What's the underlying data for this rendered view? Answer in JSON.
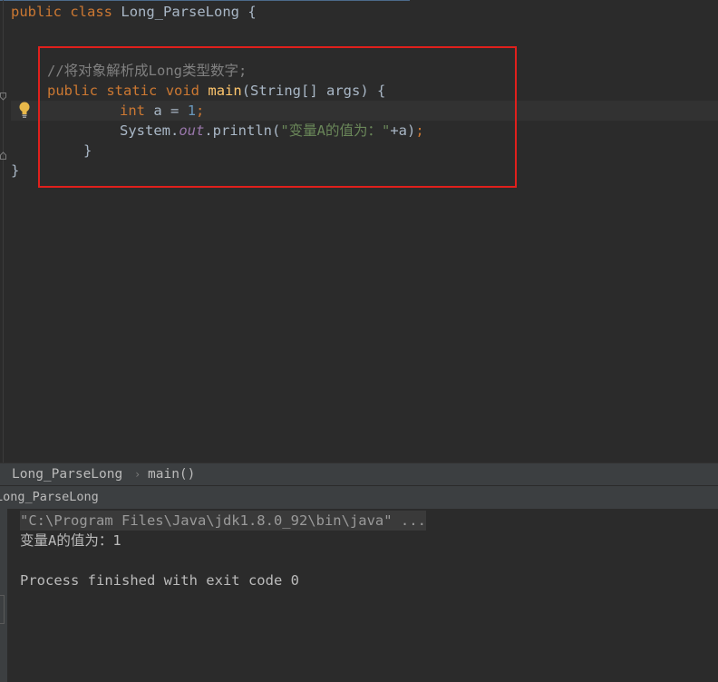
{
  "editor": {
    "class_decl": {
      "kw_public": "public",
      "kw_class": "class",
      "name": "Long_ParseLong",
      "brace": "{"
    },
    "comment": "//将对象解析成Long类型数字;",
    "method_decl": {
      "kw_public": "public",
      "kw_static": "static",
      "kw_void": "void",
      "name": "main",
      "params": "(String[] args) {"
    },
    "var_decl": {
      "kw_int": "int",
      "rest": "a =",
      "value": "1",
      "semicolon": ";"
    },
    "print_stmt": {
      "prefix": "System.",
      "field": "out",
      "call": ".println(",
      "string": "\"变量A的值为：\"",
      "suffix": "+a)",
      "semicolon": ";"
    },
    "method_close": "}",
    "class_close": "}"
  },
  "breadcrumb": {
    "items": [
      "Long_ParseLong",
      "main()"
    ],
    "separator": "›"
  },
  "run_panel": {
    "title": "Long_ParseLong",
    "lines": [
      "\"C:\\Program Files\\Java\\jdk1.8.0_92\\bin\\java\" ...",
      "变量A的值为：1",
      "",
      "Process finished with exit code 0"
    ]
  },
  "colors": {
    "keyword": "#cc7832",
    "function": "#ffc66d",
    "comment": "#808080",
    "number": "#6897bb",
    "string": "#6a8759",
    "field": "#9876aa",
    "highlight_box": "#e0201c",
    "background": "#2b2b2b"
  },
  "icons": [
    "lightbulb-icon",
    "fold-icon"
  ]
}
